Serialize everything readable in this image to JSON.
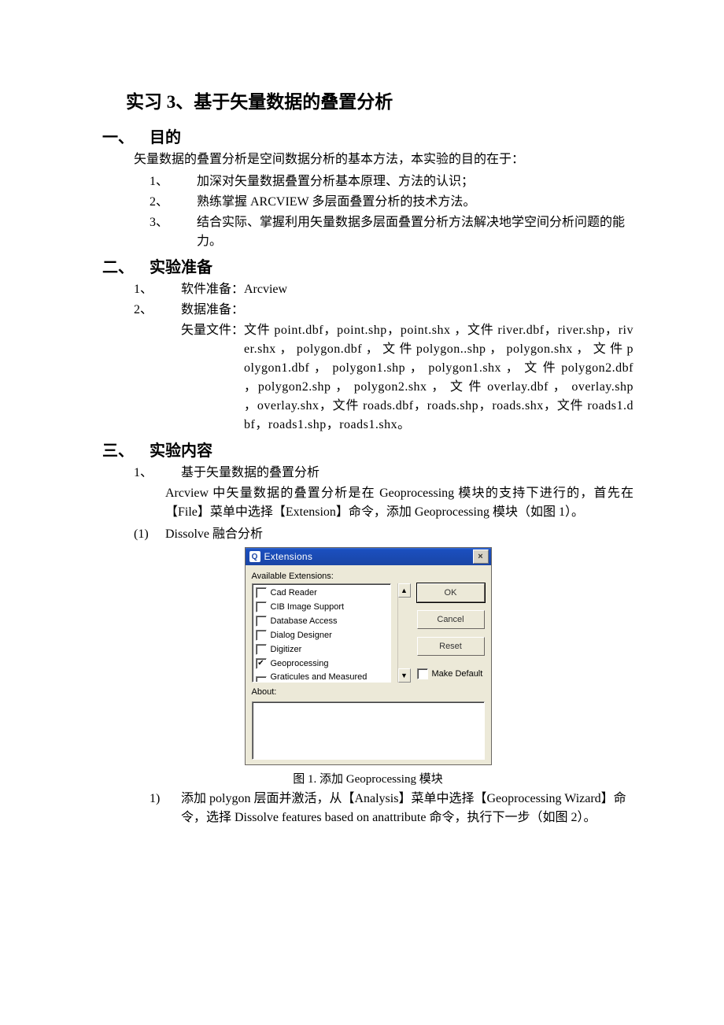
{
  "title": "实习 3、基于矢量数据的叠置分析",
  "s1": {
    "heading_num": "一、",
    "heading": "目的",
    "intro": "矢量数据的叠置分析是空间数据分析的基本方法，本实验的目的在于：",
    "items": [
      {
        "num": "1、",
        "txt": "加深对矢量数据叠置分析基本原理、方法的认识；"
      },
      {
        "num": "2、",
        "txt": "熟练掌握 ARCVIEW 多层面叠置分析的技术方法。"
      },
      {
        "num": "3、",
        "txt": "结合实际、掌握利用矢量数据多层面叠置分析方法解决地学空间分析问题的能力。"
      }
    ]
  },
  "s2": {
    "heading_num": "二、",
    "heading": "实验准备",
    "items": [
      {
        "num": "1、",
        "txt": "软件准备：Arcview"
      },
      {
        "num": "2、",
        "txt": "数据准备："
      }
    ],
    "vector_lead": "矢量文件：",
    "vector_body": "文件 point.dbf，point.shp，point.shx ，文件 river.dbf，river.shp，river.shx ， polygon.dbf ， 文 件 polygon..shp ， polygon.shx ， 文 件 polygon1.dbf ， polygon1.shp ， polygon1.shx ， 文 件 polygon2.dbf ，polygon2.shp ， polygon2.shx ， 文 件 overlay.dbf ， overlay.shp ，overlay.shx，文件 roads.dbf，roads.shp，roads.shx，文件 roads1.dbf，roads1.shp，roads1.shx。"
  },
  "s3": {
    "heading_num": "三、",
    "heading": "实验内容",
    "i1_num": "1、",
    "i1_txt": "基于矢量数据的叠置分析",
    "i1_para": "Arcview 中矢量数据的叠置分析是在 Geoprocessing 模块的支持下进行的，首先在【File】菜单中选择【Extension】命令，添加 Geoprocessing 模块（如图 1）。",
    "sub1_num": "(1)",
    "sub1_txt": "Dissolve 融合分析",
    "step1_num": "1)",
    "step1_txt": "添加 polygon 层面并激活，从【Analysis】菜单中选择【Geoprocessing Wizard】命令，选择 Dissolve features based on anattribute 命令，执行下一步（如图 2）。"
  },
  "dialog": {
    "title": "Extensions",
    "icon": "Q",
    "close": "×",
    "available": "Available Extensions:",
    "items": [
      {
        "checked": false,
        "label": "Cad Reader"
      },
      {
        "checked": false,
        "label": "CIB Image Support"
      },
      {
        "checked": false,
        "label": "Database Access"
      },
      {
        "checked": false,
        "label": "Dialog Designer"
      },
      {
        "checked": false,
        "label": "Digitizer"
      },
      {
        "checked": true,
        "label": "Geoprocessing"
      },
      {
        "checked": false,
        "label": "Graticules and Measured Grids"
      }
    ],
    "scroll_up": "▲",
    "scroll_down": "▼",
    "ok": "OK",
    "cancel": "Cancel",
    "reset": "Reset",
    "make_default": "Make Default",
    "about": "About:"
  },
  "caption": "图 1.   添加 Geoprocessing 模块"
}
